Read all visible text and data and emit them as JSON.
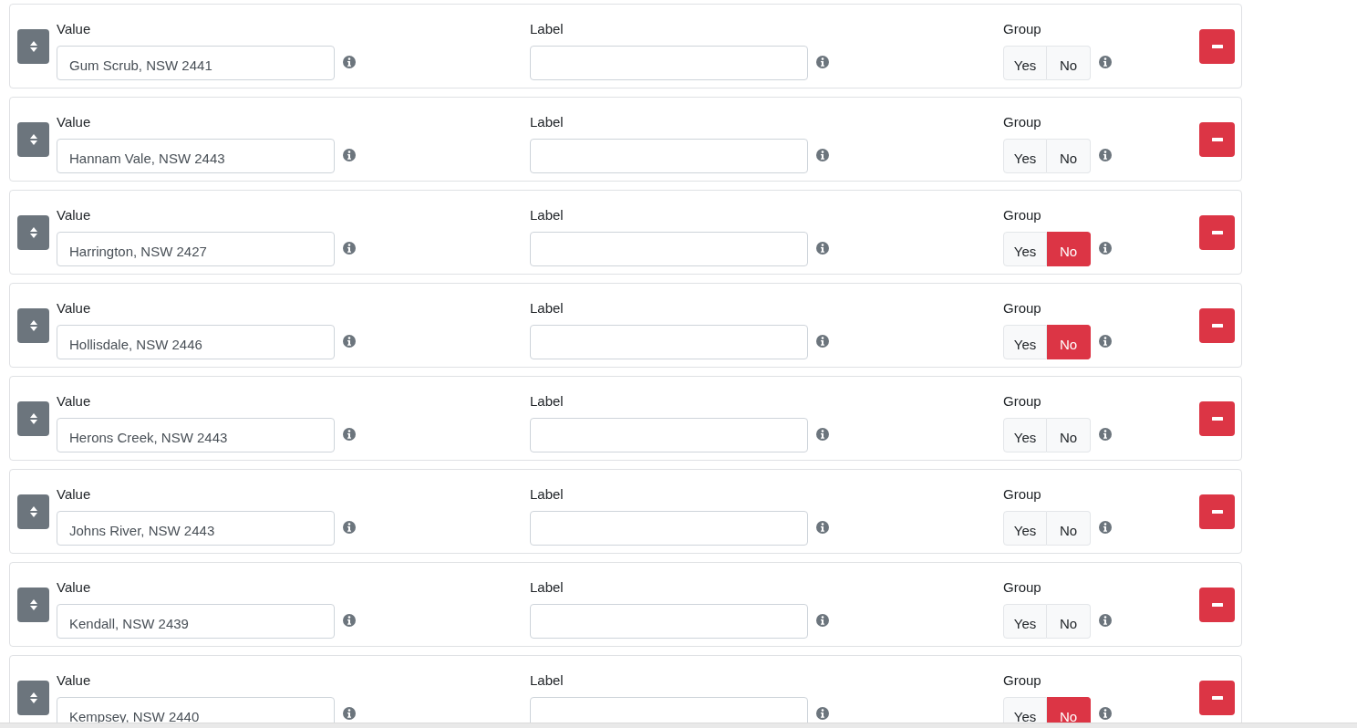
{
  "rows": [
    {
      "value_heading": "Value",
      "value": "Gum Scrub, NSW 2441",
      "label_heading": "Label",
      "group_heading": "Group",
      "group_options": [
        {
          "label": "Yes",
          "selected": false
        },
        {
          "label": "No",
          "selected": false
        }
      ]
    },
    {
      "value_heading": "Value",
      "value": "Hannam Vale, NSW 2443",
      "label_heading": "Label",
      "group_heading": "Group",
      "group_options": [
        {
          "label": "Yes",
          "selected": false
        },
        {
          "label": "No",
          "selected": false
        }
      ]
    },
    {
      "value_heading": "Value",
      "value": "Harrington, NSW 2427",
      "label_heading": "Label",
      "group_heading": "Group",
      "group_options": [
        {
          "label": "Yes",
          "selected": false
        },
        {
          "label": "No",
          "selected": true
        }
      ]
    },
    {
      "value_heading": "Value",
      "value": "Hollisdale, NSW 2446",
      "label_heading": "Label",
      "group_heading": "Group",
      "group_options": [
        {
          "label": "Yes",
          "selected": false
        },
        {
          "label": "No",
          "selected": true
        }
      ]
    },
    {
      "value_heading": "Value",
      "value": "Herons Creek, NSW 2443",
      "label_heading": "Label",
      "group_heading": "Group",
      "group_options": [
        {
          "label": "Yes",
          "selected": false
        },
        {
          "label": "No",
          "selected": false
        }
      ]
    },
    {
      "value_heading": "Value",
      "value": "Johns River, NSW 2443",
      "label_heading": "Label",
      "group_heading": "Group",
      "group_options": [
        {
          "label": "Yes",
          "selected": false
        },
        {
          "label": "No",
          "selected": false
        }
      ]
    },
    {
      "value_heading": "Value",
      "value": "Kendall, NSW 2439",
      "label_heading": "Label",
      "group_heading": "Group",
      "group_options": [
        {
          "label": "Yes",
          "selected": false
        },
        {
          "label": "No",
          "selected": false
        }
      ]
    },
    {
      "value_heading": "Value",
      "value": "Kempsey, NSW 2440",
      "label_heading": "Label",
      "group_heading": "Group",
      "group_options": [
        {
          "label": "Yes",
          "selected": false
        },
        {
          "label": "No",
          "selected": true
        }
      ]
    }
  ]
}
